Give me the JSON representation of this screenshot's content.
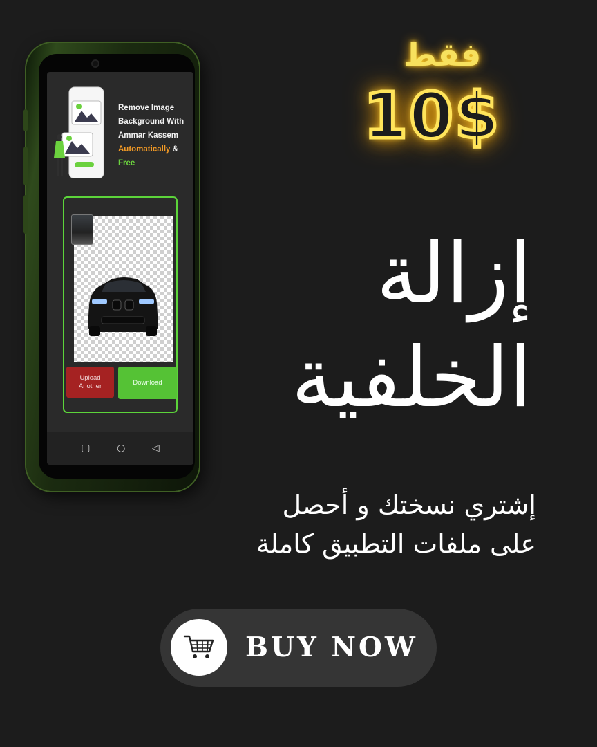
{
  "price": {
    "label": "فقط",
    "value": "10$"
  },
  "headline": {
    "line1": "إزالة",
    "line2": "الخلفية"
  },
  "subline": {
    "line1": "إشتري نسختك و أحصل",
    "line2": "على ملفات التطبيق كاملة"
  },
  "buy_button": {
    "label": "BUY NOW",
    "icon": "shopping-cart-icon"
  },
  "phone_app": {
    "promo": {
      "line1": "Remove Image",
      "line2": "Background With",
      "line3": "Ammar Kassem",
      "highlight_auto": "Automatically",
      "amp": " &",
      "highlight_free": "Free"
    },
    "upload_label": "Upload Another",
    "download_label": "Download",
    "nav": {
      "recent_icon": "▢",
      "home_icon": "○",
      "back_icon": "◁"
    }
  },
  "colors": {
    "background": "#1c1c1c",
    "neon": "#ffe45a",
    "accent_green": "#55c235",
    "accent_red": "#a52222",
    "accent_orange": "#f39a25"
  }
}
